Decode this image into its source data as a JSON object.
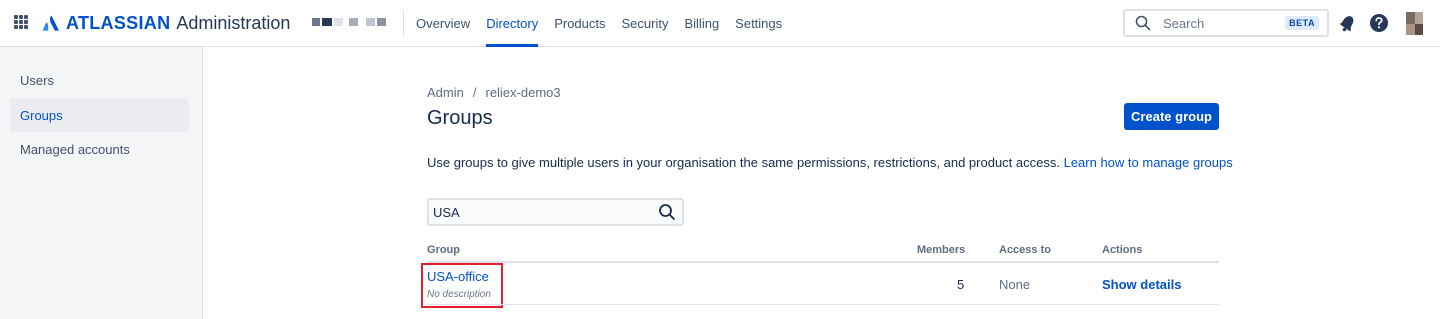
{
  "topbar": {
    "brand": "ATLASSIAN",
    "product": "Administration",
    "nav": [
      "Overview",
      "Directory",
      "Products",
      "Security",
      "Billing",
      "Settings"
    ],
    "active_nav": "Directory",
    "search_placeholder": "Search",
    "search_badge": "BETA",
    "icons": [
      "app-switcher-icon",
      "notifications-icon",
      "help-icon",
      "avatar"
    ]
  },
  "sidebar": {
    "items": [
      {
        "label": "Users"
      },
      {
        "label": "Groups"
      },
      {
        "label": "Managed accounts"
      }
    ],
    "active": "Groups"
  },
  "main": {
    "breadcrumb": [
      "Admin",
      "reliex-demo3"
    ],
    "breadcrumb_sep": "/",
    "title": "Groups",
    "create_button": "Create group",
    "description": "Use groups to give multiple users in your organisation the same permissions, restrictions, and product access.",
    "learn_link": "Learn how to manage groups",
    "filter_value": "USA",
    "table": {
      "headers": {
        "group": "Group",
        "members": "Members",
        "access": "Access to",
        "actions": "Actions"
      },
      "rows": [
        {
          "name": "USA-office",
          "description": "No description",
          "members": "5",
          "access": "None",
          "action": "Show details"
        }
      ]
    }
  },
  "colors": {
    "primary": "#0052cc",
    "text": "#172b4d",
    "muted": "#5e6c84",
    "sidebar_bg": "#f4f5f7",
    "highlight": "#e5202e"
  }
}
